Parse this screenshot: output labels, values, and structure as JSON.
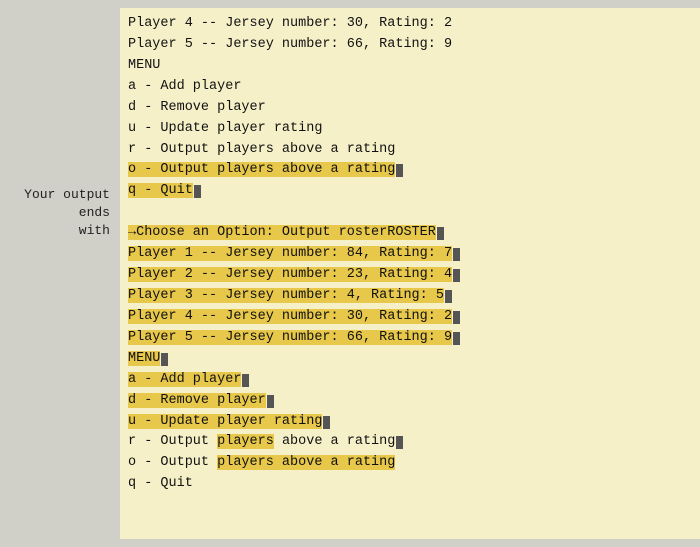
{
  "left_label": {
    "line1": "Your output ends",
    "line2": "with"
  },
  "terminal": {
    "lines_top": [
      "Player 4 -- Jersey number: 30, Rating: 2",
      "Player 5 -- Jersey number: 66, Rating: 9",
      "MENU",
      "a - Add player",
      "d - Remove player",
      "u - Update player rating",
      "r - Output players above a rating",
      "o - Output players above a rating",
      "q - Quit"
    ],
    "prompt_line": "→Choose an Option: Output rosterROSTER",
    "lines_bottom": [
      "Player 1 -- Jersey number: 84, Rating: 7",
      "Player 2 -- Jersey number: 23, Rating: 4",
      "Player 3 -- Jersey number: 4, Rating: 5",
      "Player 4 -- Jersey number: 30, Rating: 2",
      "Player 5 -- Jersey number: 66, Rating: 9",
      "MENU",
      "a - Add player",
      "d - Remove player",
      "u - Update player rating",
      "r - Output players above a rating",
      "o - Output players above a rating",
      "q - Quit"
    ]
  }
}
